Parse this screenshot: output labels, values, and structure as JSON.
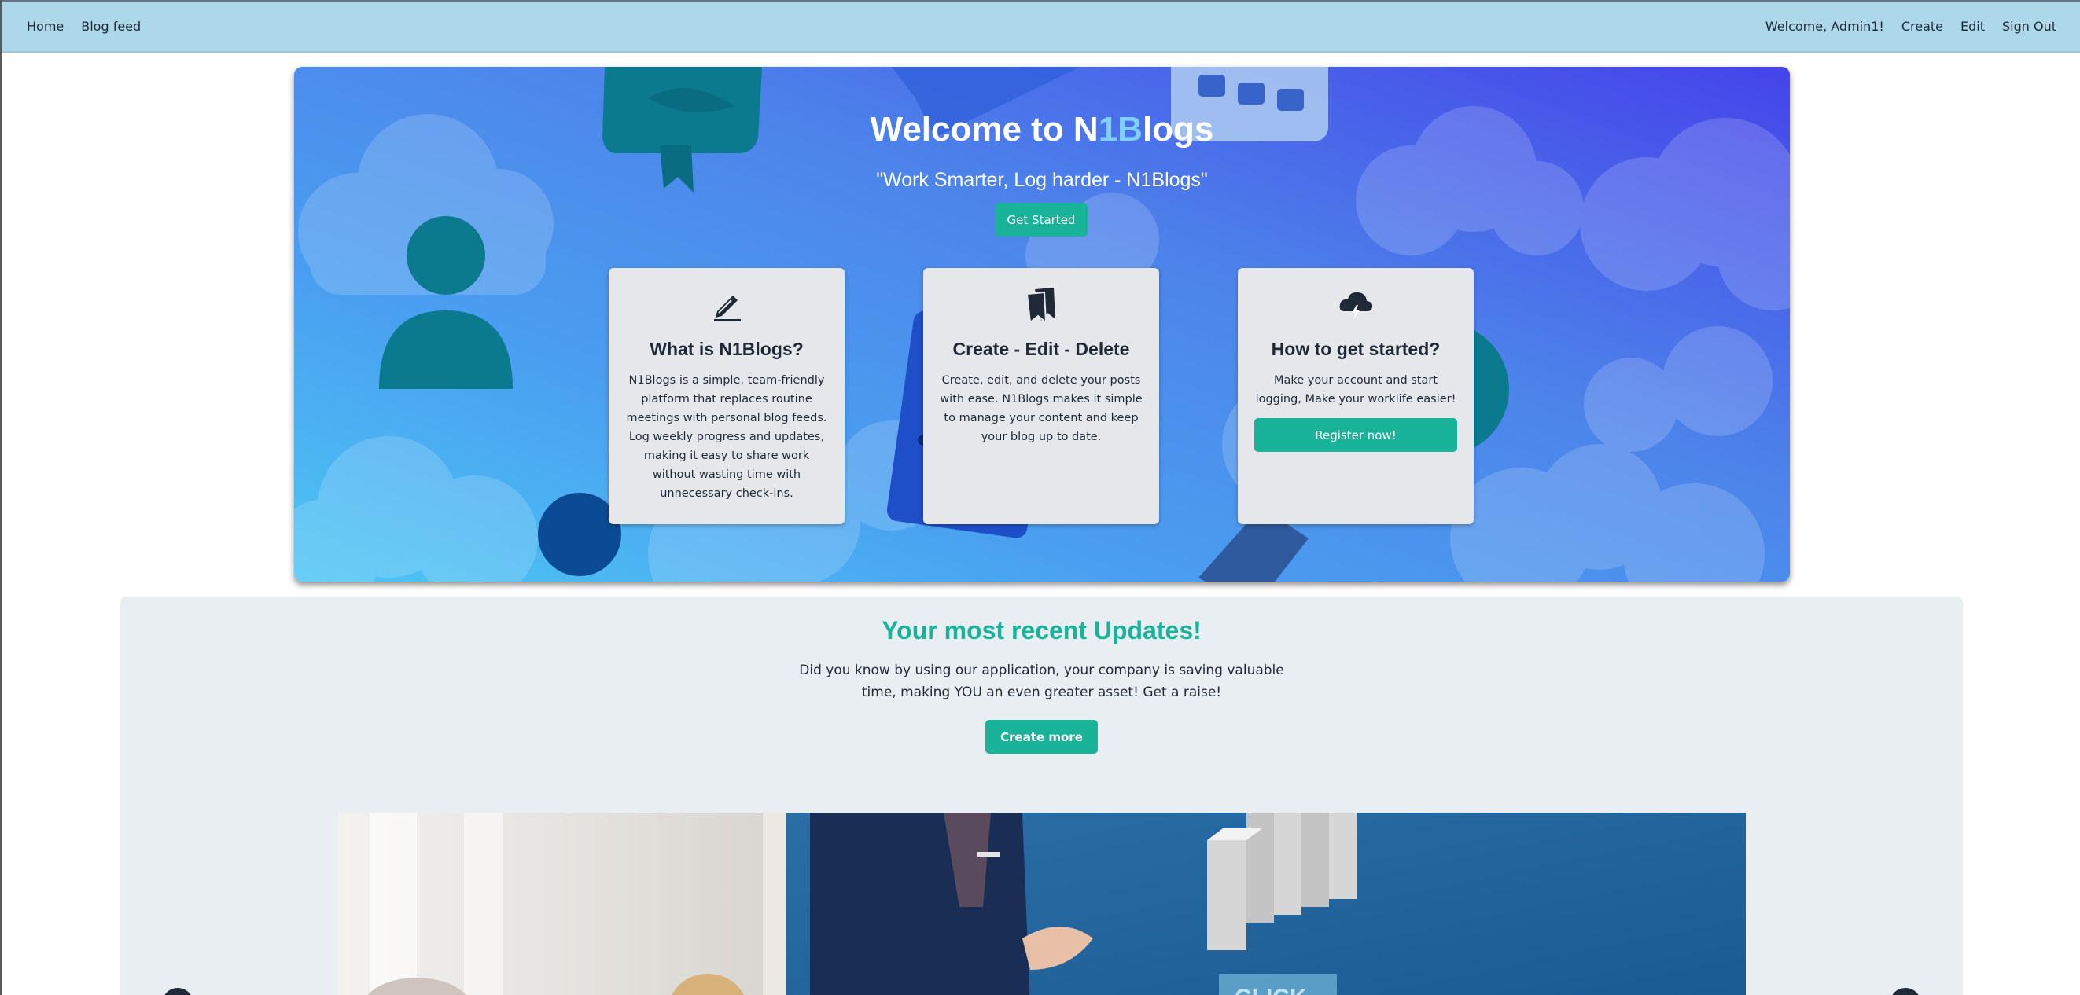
{
  "nav": {
    "left": [
      "Home",
      "Blog feed"
    ],
    "right": [
      "Welcome, Admin1!",
      "Create",
      "Edit",
      "Sign Out"
    ]
  },
  "hero": {
    "title_before": "Welcome to N",
    "title_accent": "1B",
    "title_after": "logs",
    "tagline": "\"Work Smarter, Log harder - N1Blogs\"",
    "cta_label": "Get Started"
  },
  "cards": [
    {
      "icon": "pencil-icon",
      "title": "What is N1Blogs?",
      "text": "N1Blogs is a simple, team-friendly platform that replaces routine meetings with personal blog feeds. Log weekly progress and updates, making it easy to share work without wasting time with unnecessary check-ins."
    },
    {
      "icon": "bookmarks-icon",
      "title": "Create - Edit - Delete",
      "text": "Create, edit, and delete your posts with ease. N1Blogs makes it simple to manage your content and keep your blog up to date."
    },
    {
      "icon": "cloud-lightning-icon",
      "title": "How to get started?",
      "text": "Make your account and start logging, Make your worklife easier!",
      "button_label": "Register now!"
    }
  ],
  "updates": {
    "title": "Your most recent Updates!",
    "text_line1": "Did you know by using our application, your company is saving valuable",
    "text_line2": "time, making YOU an even greater asset! Get a raise!",
    "button_label": "Create more"
  },
  "colors": {
    "navbar": "#add8ea",
    "accent": "#19b39a",
    "card": "#e5e7eb",
    "section": "#e8eef1"
  }
}
